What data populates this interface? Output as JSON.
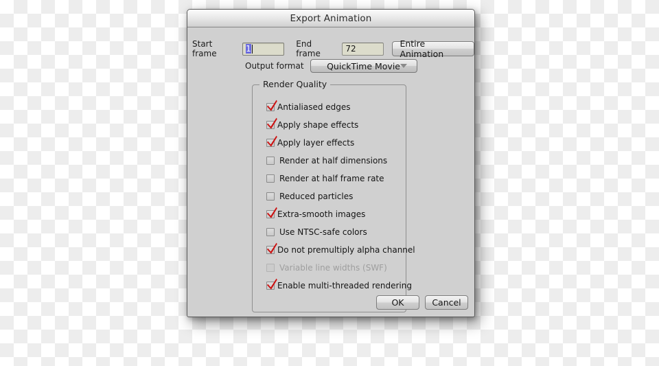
{
  "dialog": {
    "title": "Export Animation",
    "frame_row": {
      "start_label": "Start frame",
      "start_value": "1",
      "end_label": "End frame",
      "end_value": "72",
      "entire_button": "Entire Animation"
    },
    "format_row": {
      "label": "Output format",
      "selected": "QuickTime Movie",
      "arrow_icon": "chevron-down-icon"
    },
    "render_quality": {
      "title": "Render Quality",
      "options": [
        {
          "label": "Antialiased edges",
          "checked": true,
          "enabled": true
        },
        {
          "label": "Apply shape effects",
          "checked": true,
          "enabled": true
        },
        {
          "label": "Apply layer effects",
          "checked": true,
          "enabled": true
        },
        {
          "label": "Render at half dimensions",
          "checked": false,
          "enabled": true
        },
        {
          "label": "Render at half frame rate",
          "checked": false,
          "enabled": true
        },
        {
          "label": "Reduced particles",
          "checked": false,
          "enabled": true
        },
        {
          "label": "Extra-smooth images",
          "checked": true,
          "enabled": true
        },
        {
          "label": "Use NTSC-safe colors",
          "checked": false,
          "enabled": true
        },
        {
          "label": "Do not premultiply alpha channel",
          "checked": true,
          "enabled": true
        },
        {
          "label": "Variable line widths (SWF)",
          "checked": false,
          "enabled": false
        },
        {
          "label": "Enable multi-threaded rendering",
          "checked": true,
          "enabled": true
        }
      ]
    },
    "footer": {
      "ok_label": "OK",
      "cancel_label": "Cancel"
    },
    "colors": {
      "checkmark": "#cc1111",
      "window_background": "#d0d0d0",
      "field_background": "#dcdccb",
      "selection": "#6a6adf",
      "disabled_text": "#9e9e9e"
    }
  }
}
